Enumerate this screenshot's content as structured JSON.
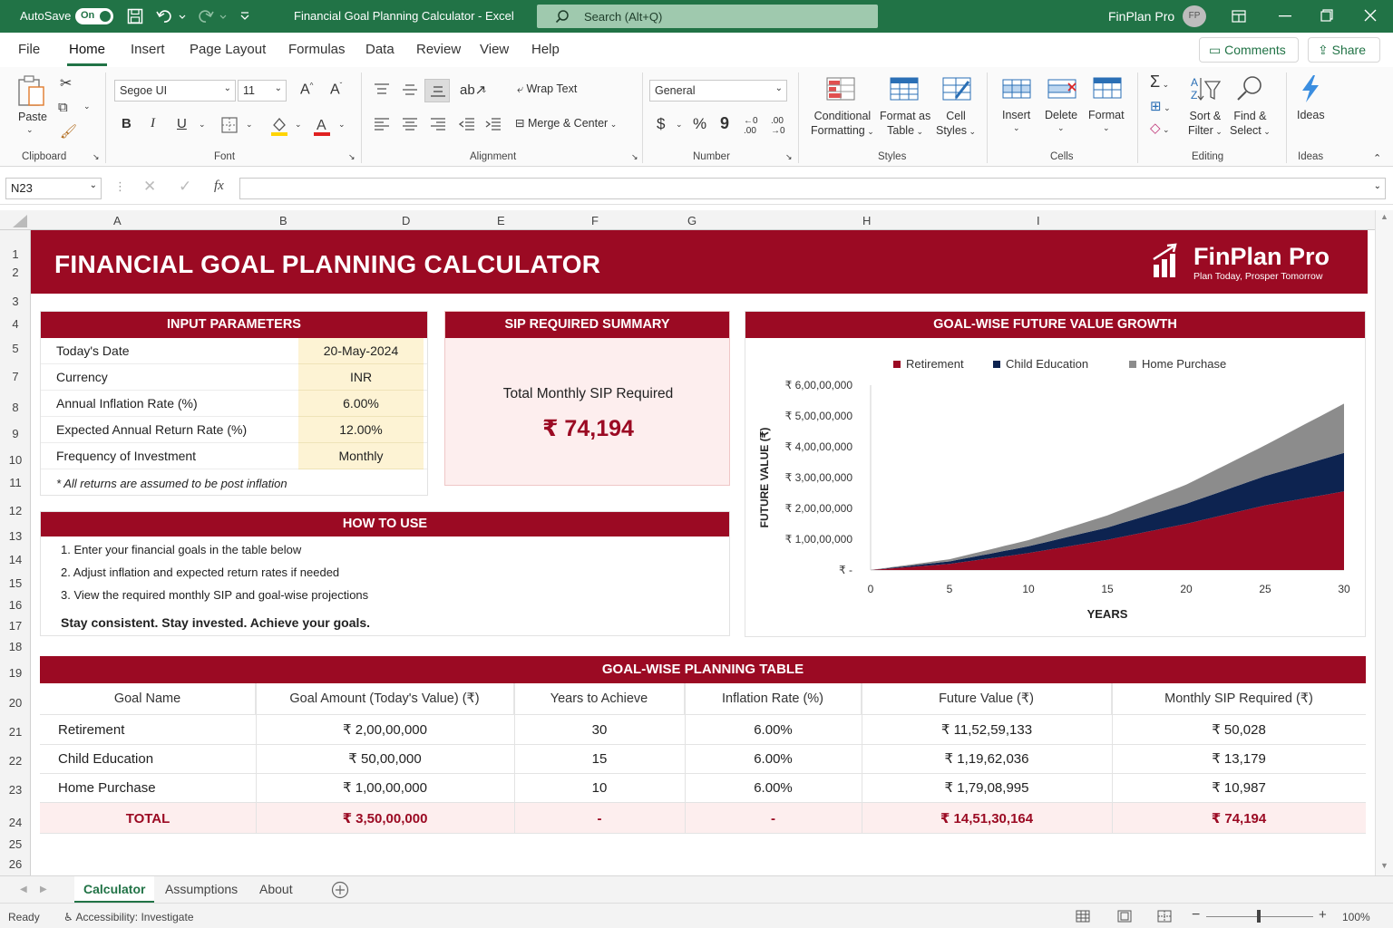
{
  "window": {
    "autosave_label": "AutoSave",
    "autosave_state": "On",
    "title": "Financial Goal Planning Calculator - Excel",
    "search_placeholder": "Search (Alt+Q)",
    "user_name": "FinPlan Pro",
    "user_initials": "FP"
  },
  "menu": {
    "tabs": [
      "File",
      "Home",
      "Insert",
      "Page Layout",
      "Formulas",
      "Data",
      "Review",
      "View",
      "Help"
    ],
    "comments": "Comments",
    "share": "Share"
  },
  "ribbon": {
    "clipboard": {
      "paste": "Paste",
      "label": "Clipboard"
    },
    "font": {
      "name": "Segoe UI",
      "size": "11",
      "label": "Font",
      "bold": "B",
      "italic": "I",
      "underline": "U"
    },
    "alignment": {
      "wrap": "Wrap Text",
      "merge": "Merge & Center",
      "label": "Alignment"
    },
    "number": {
      "format": "General",
      "label": "Number",
      "currency": "$",
      "percent": "%",
      "comma": "9"
    },
    "styles": {
      "conditional": [
        "Conditional",
        "Formatting"
      ],
      "format_table": [
        "Format as",
        "Table"
      ],
      "cell_styles": [
        "Cell",
        "Styles"
      ],
      "label": "Styles"
    },
    "cells": {
      "insert": "Insert",
      "delete": "Delete",
      "format": "Format",
      "label": "Cells"
    },
    "editing": {
      "sort": [
        "Sort &",
        "Filter"
      ],
      "find": [
        "Find &",
        "Select"
      ],
      "label": "Editing"
    },
    "ideas": {
      "btn": "Ideas",
      "label": "Ideas"
    }
  },
  "formula_bar": {
    "name_box": "N23",
    "fx": "fx",
    "content": ""
  },
  "columns": [
    "A",
    "B",
    "D",
    "E",
    "F",
    "G",
    "H",
    "I"
  ],
  "rows": [
    "1",
    "2",
    "3",
    "4",
    "5",
    "7",
    "8",
    "9",
    "10",
    "11",
    "12",
    "13",
    "14",
    "15",
    "16",
    "17",
    "18",
    "19",
    "20",
    "21",
    "22",
    "23",
    "24",
    "25",
    "26"
  ],
  "banner": {
    "title": "FINANCIAL GOAL PLANNING CALCULATOR",
    "brand": "FinPlan Pro",
    "tagline": "Plan Today, Prosper Tomorrow"
  },
  "inputs": {
    "header": "INPUT PARAMETERS",
    "rows": [
      {
        "label": "Today's Date",
        "value": "20-May-2024"
      },
      {
        "label": "Currency",
        "value": "INR"
      },
      {
        "label": "Annual Inflation Rate (%)",
        "value": "6.00%"
      },
      {
        "label": "Expected Annual Return Rate (%)",
        "value": "12.00%"
      },
      {
        "label": "Frequency of Investment",
        "value": "Monthly"
      }
    ],
    "note": "* All returns are assumed to be post inflation"
  },
  "sip_summary": {
    "header": "SIP REQUIRED SUMMARY",
    "label": "Total Monthly SIP Required",
    "value": "₹ 74,194"
  },
  "how_to_use": {
    "header": "HOW TO USE",
    "steps": [
      "1.  Enter your financial goals in the table below",
      "2.  Adjust inflation and expected return rates if needed",
      "3.  View the required monthly SIP and goal-wise projections"
    ],
    "tagline": "Stay consistent. Stay invested. Achieve your goals."
  },
  "chart_data": {
    "type": "area",
    "title": "GOAL-WISE FUTURE VALUE GROWTH",
    "xlabel": "YEARS",
    "ylabel": "FUTURE VALUE (₹)",
    "x_ticks": [
      "0",
      "5",
      "10",
      "15",
      "20",
      "25",
      "30"
    ],
    "y_ticks": [
      "₹ -",
      "₹ 1,00,00,000",
      "₹ 2,00,00,000",
      "₹ 3,00,00,000",
      "₹ 4,00,00,000",
      "₹ 5,00,00,000",
      "₹ 6,00,00,000"
    ],
    "xlim": [
      0,
      30
    ],
    "ylim": [
      0,
      60000000
    ],
    "stacked": true,
    "legend": "top",
    "x": [
      0,
      5,
      10,
      15,
      20,
      25,
      30
    ],
    "series": [
      {
        "name": "Retirement",
        "color": "#9b0a23",
        "values": [
          0,
          2000000,
          5500000,
          9800000,
          15000000,
          21000000,
          25500000
        ]
      },
      {
        "name": "Child Education",
        "color": "#0d2350",
        "values": [
          0,
          800000,
          2200000,
          4000000,
          6500000,
          9500000,
          12500000
        ]
      },
      {
        "name": "Home Purchase",
        "color": "#8c8c8c",
        "values": [
          0,
          700000,
          2000000,
          3900000,
          6200000,
          10000000,
          16000000
        ]
      }
    ]
  },
  "goal_table": {
    "header": "GOAL-WISE PLANNING TABLE",
    "columns": [
      "Goal Name",
      "Goal Amount (Today's Value) (₹)",
      "Years to Achieve",
      "Inflation Rate (%)",
      "Future Value (₹)",
      "Monthly SIP Required (₹)"
    ],
    "rows": [
      [
        "Retirement",
        "₹ 2,00,00,000",
        "30",
        "6.00%",
        "₹ 11,52,59,133",
        "₹ 50,028"
      ],
      [
        "Child Education",
        "₹ 50,00,000",
        "15",
        "6.00%",
        "₹ 1,19,62,036",
        "₹ 13,179"
      ],
      [
        "Home Purchase",
        "₹ 1,00,00,000",
        "10",
        "6.00%",
        "₹ 1,79,08,995",
        "₹ 10,987"
      ]
    ],
    "total": [
      "TOTAL",
      "₹ 3,50,00,000",
      "-",
      "-",
      "₹ 14,51,30,164",
      "₹ 74,194"
    ]
  },
  "sheets": [
    "Calculator",
    "Assumptions",
    "About"
  ],
  "status": {
    "ready": "Ready",
    "accessibility": "Accessibility: Investigate",
    "zoom": "100%"
  }
}
